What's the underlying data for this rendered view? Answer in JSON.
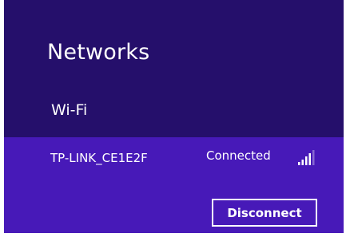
{
  "panel": {
    "title": "Networks",
    "section_header": "Wi-Fi",
    "background_color": "#250f6b"
  },
  "network": {
    "name": "TP-LINK_CE1E2F",
    "status": "Connected",
    "signal_icon": "signal-strength-icon",
    "signal_bars_filled": 4,
    "signal_bars_total": 5,
    "highlight_color": "#4719b8",
    "disconnect_label": "Disconnect"
  }
}
